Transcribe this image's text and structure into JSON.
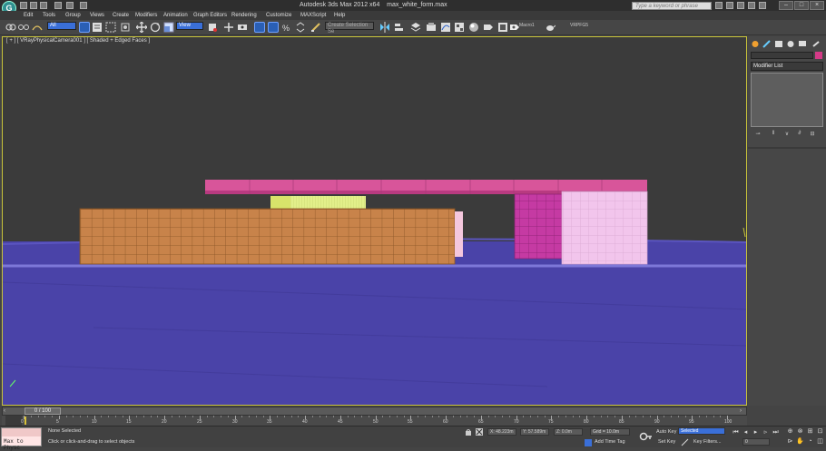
{
  "app": {
    "title": "Autodesk 3ds Max 2012 x64",
    "file": "max_white_form.max",
    "search_placeholder": "Type a keyword or phrase",
    "logo": "3ds-max-logo-icon"
  },
  "menu": [
    "Edit",
    "Tools",
    "Group",
    "Views",
    "Create",
    "Modifiers",
    "Animation",
    "Graph Editors",
    "Rendering",
    "Customize",
    "MAXScript",
    "Help"
  ],
  "toolbar": {
    "selection_filter": "All",
    "ref_coord": "View",
    "named_selection_placeholder": "Create Selection Se",
    "macro_label": "Macro1",
    "vray_label": "VRPFG5"
  },
  "viewport": {
    "label": "[ + ] [ VRayPhysicalCamera001 ] [ Shaded + Edged Faces ]",
    "border_color": "#c9c43a",
    "ground_color": "#4a43a8",
    "colors": {
      "top_slab": "#d8559a",
      "orange_block": "#c8834a",
      "yellow_strip": "#e2ef8a",
      "magenta_box": "#c53aa3",
      "light_pink_box": "#f2c5ec",
      "thin_pink": "#f4c7dd"
    }
  },
  "command_panel": {
    "modifier_list": "Modifier List",
    "object_color": "#d43a87"
  },
  "time": {
    "slider": "0 / 100",
    "ticks": [
      "0",
      "5",
      "10",
      "15",
      "20",
      "25",
      "30",
      "35",
      "40",
      "45",
      "50",
      "55",
      "60",
      "65",
      "70",
      "75",
      "80",
      "85",
      "90",
      "95",
      "100"
    ]
  },
  "status": {
    "maxscript": "Max to Physc",
    "selection": "None Selected",
    "prompt": "Click or click-and-drag to select objects",
    "x": "X: 48.223m",
    "y": "Y: 57.589m",
    "z": "Z: 0.0m",
    "grid": "Grid = 10.0m",
    "add_time_tag": "Add Time Tag",
    "auto_key": "Auto Key",
    "selected_dropdown": "Selected",
    "set_key": "Set Key",
    "key_filters": "Key Filters...",
    "frame": "0"
  }
}
